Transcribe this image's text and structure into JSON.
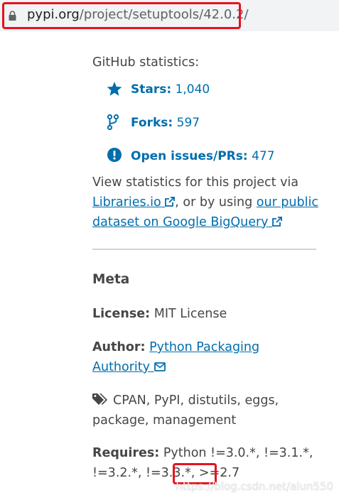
{
  "browser": {
    "url_host": "pypi.org",
    "url_path": "/project/setuptools/42.0.2/"
  },
  "github": {
    "heading": "GitHub statistics:",
    "stars_label": "Stars:",
    "stars_value": "1,040",
    "forks_label": "Forks:",
    "forks_value": "597",
    "issues_label": "Open issues/PRs:",
    "issues_value": "477",
    "stats_text_1": "View statistics for this project via",
    "libraries_link": "Libraries.io",
    "stats_text_2": ", or by using",
    "bigquery_link_1": "our public",
    "bigquery_link_2": "dataset on Google BigQuery"
  },
  "meta": {
    "heading": "Meta",
    "license_label": "License:",
    "license_value": "MIT License",
    "author_label": "Author:",
    "author_link_1": "Python Packaging",
    "author_link_2": "Authority",
    "keywords_1": "CPAN, PyPI, distutils, eggs,",
    "keywords_2": "package, management",
    "requires_label": "Requires:",
    "requires_1": "Python !=3.0.*, !=3.1.*,",
    "requires_2": "!=3.2.*, !=3.3.*,",
    "requires_highlight": ">=2.7"
  },
  "watermark": "https://blog.csdn.net/alun550",
  "colors": {
    "link": "#006dad",
    "highlight": "#e5131e"
  },
  "icons": [
    "lock-icon",
    "star-icon",
    "fork-icon",
    "alert-icon",
    "external-link-icon",
    "mail-icon",
    "tags-icon"
  ]
}
